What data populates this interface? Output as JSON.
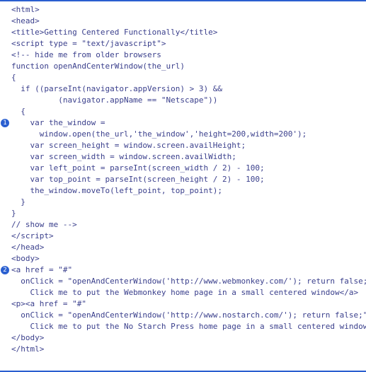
{
  "annotations": {
    "a1": "1",
    "a2": "2"
  },
  "lines": {
    "l0": "<html>",
    "l1": "<head>",
    "l2": "<title>Getting Centered Functionally</title>",
    "l3": "<script type = \"text/javascript\">",
    "l4": "<!-- hide me from older browsers",
    "l5": "function openAndCenterWindow(the_url)",
    "l6": "{",
    "l7": "  if ((parseInt(navigator.appVersion) > 3) &&",
    "l8": "          (navigator.appName == \"Netscape\"))",
    "l9": "  {",
    "l10": "    var the_window =",
    "l11": "      window.open(the_url,'the_window','height=200,width=200');",
    "l12": "    var screen_height = window.screen.availHeight;",
    "l13": "    var screen_width = window.screen.availWidth;",
    "l14": "    var left_point = parseInt(screen_width / 2) - 100;",
    "l15": "    var top_point = parseInt(screen_height / 2) - 100;",
    "l16": "    the_window.moveTo(left_point, top_point);",
    "l17": "  }",
    "l18": "}",
    "l19": "",
    "l20": "",
    "l21": "// show me -->",
    "l22": "</scr",
    "l22b": "ipt>",
    "l23": "</head>",
    "l24": "<body>",
    "l25": "<a href = \"#\"",
    "l26": "  onClick = \"openAndCenterWindow('http://www.webmonkey.com/'); return false;\">",
    "l27": "    Click me to put the Webmonkey home page in a small centered window</a>",
    "l28": "<p><a href = \"#\"",
    "l29": "  onClick = \"openAndCenterWindow('http://www.nostarch.com/'); return false;\">",
    "l30": "    Click me to put the No Starch Press home page in a small centered window</a>",
    "l31": "",
    "l32": "</body>",
    "l33": "</html>"
  }
}
